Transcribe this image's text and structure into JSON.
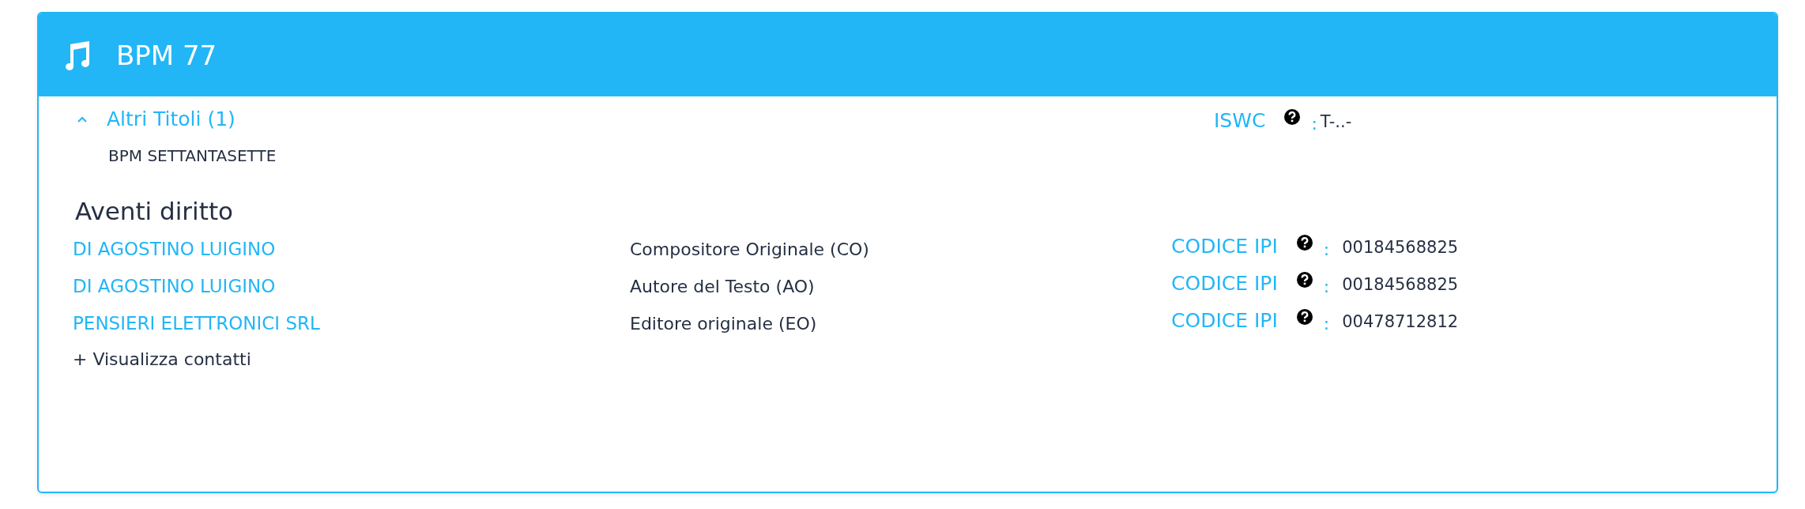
{
  "card": {
    "title": "BPM 77"
  },
  "other_titles": {
    "label": "Altri Titoli (1)",
    "expanded": true,
    "items": [
      "BPM SETTANTASETTE"
    ]
  },
  "iswc": {
    "label": "ISWC",
    "separator": ":",
    "value": "T-..-"
  },
  "rights_holders": {
    "heading": "Aventi diritto",
    "rows": [
      {
        "name": "DI AGOSTINO LUIGINO",
        "role": "Compositore Originale (CO)",
        "code_label": "CODICE IPI",
        "separator": ":",
        "code": "00184568825"
      },
      {
        "name": "DI AGOSTINO LUIGINO",
        "role": "Autore del Testo (AO)",
        "code_label": "CODICE IPI",
        "separator": ":",
        "code": "00184568825"
      },
      {
        "name": "PENSIERI ELETTRONICI SRL",
        "role": "Editore originale (EO)",
        "code_label": "CODICE IPI",
        "separator": ":",
        "code": "00478712812"
      }
    ],
    "show_contacts": "+ Visualizza contatti"
  }
}
